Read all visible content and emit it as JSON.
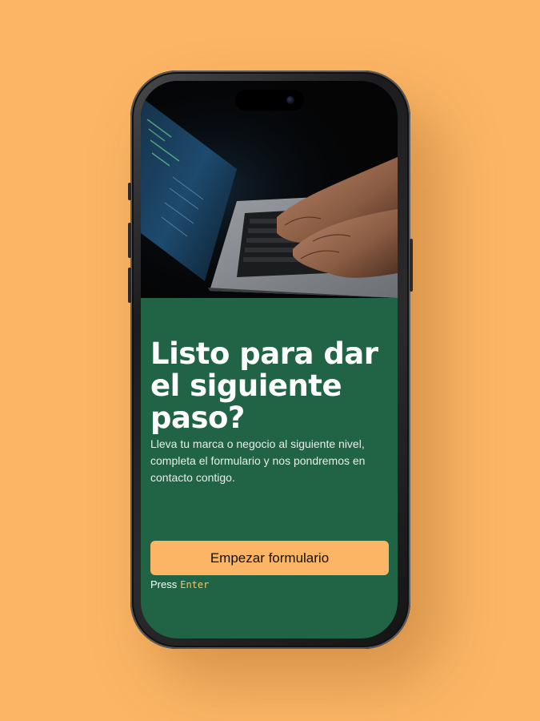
{
  "page": {
    "background_color": "#FBB565",
    "screen_color": "#206345",
    "accent_color": "#FBB565"
  },
  "hero": {
    "image_description_icon": "laptop-typing-photo"
  },
  "main": {
    "headline": "Listo para dar el siguiente paso?",
    "subtext": "Lleva tu marca o negocio al siguiente nivel, completa el formulario y nos pondremos en contacto contigo.",
    "cta_label": "Empezar formulario",
    "hint_press": "Press",
    "hint_key": "Enter"
  }
}
